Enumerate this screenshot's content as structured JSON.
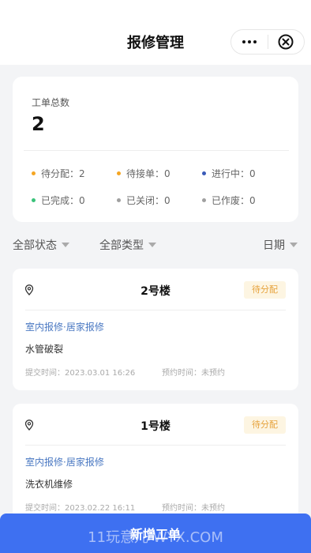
{
  "header": {
    "title": "报修管理",
    "more_icon": "more-dots-icon",
    "close_icon": "close-circle-icon"
  },
  "summary": {
    "label": "工单总数",
    "count": "2",
    "stats": [
      {
        "label": "待分配：2",
        "color": "#f5a623"
      },
      {
        "label": "待接单：0",
        "color": "#f5a623"
      },
      {
        "label": "进行中：0",
        "color": "#3a5bb8"
      },
      {
        "label": "已完成：0",
        "color": "#3ac27a"
      },
      {
        "label": "已关闭：0",
        "color": "#a0a0a0"
      },
      {
        "label": "已作废：0",
        "color": "#a0a0a0"
      }
    ]
  },
  "filters": {
    "status": "全部状态",
    "type": "全部类型",
    "date": "日期"
  },
  "orders": [
    {
      "building": "2号楼",
      "status": "待分配",
      "category": "室内报修·居家报修",
      "description": "水管破裂",
      "submit_time": "提交时间：2023.03.01 16:26",
      "appointment": "预约时间：未预约"
    },
    {
      "building": "1号楼",
      "status": "待分配",
      "category": "室内报修·居家报修",
      "description": "洗衣机维修",
      "submit_time": "提交时间：2023.02.22 16:11",
      "appointment": "预约时间：未预约"
    }
  ],
  "add_button": {
    "label": "新增工单"
  },
  "watermark": "11玩意儿 WYX.COM",
  "colors": {
    "accent": "#3e70f1",
    "badge_bg": "#fdf5e2",
    "badge_text": "#e6a23c",
    "category_link": "#4a78c2"
  }
}
